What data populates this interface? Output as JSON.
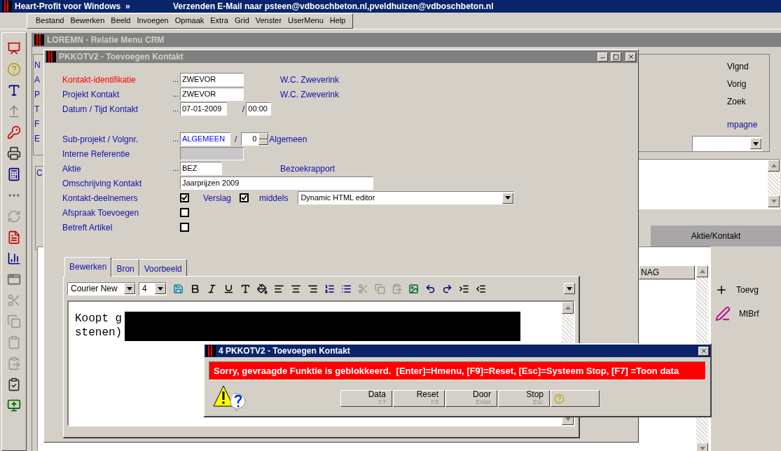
{
  "app_bar": {
    "title": "Heart-Profit voor Windows  »",
    "status": "Verzenden E-Mail naar psteen@vdboschbeton.nl,pveldhuizen@vdboschbeton.nl"
  },
  "menu": [
    "Bestand",
    "Bewerken",
    "Beeld",
    "Invoegen",
    "Opmaak",
    "Extra",
    "Grid",
    "Venster",
    "UserMenu",
    "Help"
  ],
  "background_window": {
    "title": "LOREMN - Relatie Menu CRM",
    "field_labels": [
      "N",
      "A",
      "P",
      "T",
      "F",
      "E"
    ],
    "group_label": "C",
    "nav_buttons": [
      "Vlgnd",
      "Vorig",
      "Zoek"
    ],
    "campaign_label": "mpagne",
    "tab": "Aktie/Kontakt",
    "grid_header": "NAG",
    "actions": [
      "Toevg",
      "MtBrf"
    ]
  },
  "dialog": {
    "title": "PKKOTV2 - Toevoegen Kontakt",
    "rows": [
      {
        "kind": "lookup",
        "label": "Kontakt-identifikatie",
        "highlighted": true,
        "prompt": "...",
        "value": "ZWEVOR",
        "description": "W.C. Zweverink"
      },
      {
        "kind": "lookup",
        "label": "Projekt Kontakt",
        "highlighted": false,
        "prompt": "...",
        "value": "ZWEVOR",
        "description": "W.C. Zweverink"
      },
      {
        "kind": "datetime",
        "label": "Datum / Tijd Kontakt",
        "highlighted": false,
        "prompt": "...",
        "value": "07-01-2009",
        "separator": "/",
        "time": "00:00"
      },
      {
        "kind": "subproject",
        "label": "Sub-projekt / Volgnr.",
        "highlighted": false,
        "prompt": "...",
        "value": "ALGEMEEN",
        "separator": "/",
        "number": "0",
        "description": "Algemeen"
      },
      {
        "kind": "readonly",
        "label": "Interne Referentie",
        "highlighted": false,
        "disabled": true
      },
      {
        "kind": "short_lookup",
        "label": "Aktie",
        "highlighted": false,
        "prompt": "...",
        "value": "BEZ",
        "description": "Bezoekrapport"
      },
      {
        "kind": "text",
        "label": "Omschrijving Kontakt",
        "highlighted": false,
        "value": "Jaarprijzen 2009"
      },
      {
        "kind": "checks",
        "label": "Kontakt-deelnemers",
        "highlighted": false,
        "checked": true,
        "second_label": "Verslag",
        "second_checked": true,
        "third_label": "middels",
        "select": "Dynamic HTML editor"
      },
      {
        "kind": "checkbox",
        "label": "Afspraak Toevoegen",
        "highlighted": false,
        "checked": false
      },
      {
        "kind": "checkbox",
        "label": "Betreft Artikel",
        "highlighted": false,
        "checked": false
      }
    ],
    "editor": {
      "tabs": [
        {
          "label": "Bewerken",
          "selected": true
        },
        {
          "label": "Bron",
          "selected": false
        },
        {
          "label": "Voorbeeld",
          "selected": false
        }
      ],
      "font": "Courier New",
      "size": "4",
      "lines": [
        "Koopt g",
        "stenen)"
      ]
    }
  },
  "error_dialog": {
    "title": "4 PKKOTV2 - Toevoegen Kontakt",
    "message": "Sorry, gevraagde Funktie is geblokkeerd.  [Enter]=Hmenu, [F9]=Reset, [Esc]=Systeem Stop, [F7] =Toon data",
    "buttons": [
      {
        "label": "Data",
        "key": "F7"
      },
      {
        "label": "Reset",
        "key": "F9"
      },
      {
        "label": "Door",
        "key": "Enter"
      },
      {
        "label": "Stop",
        "key": "Esc"
      }
    ]
  }
}
